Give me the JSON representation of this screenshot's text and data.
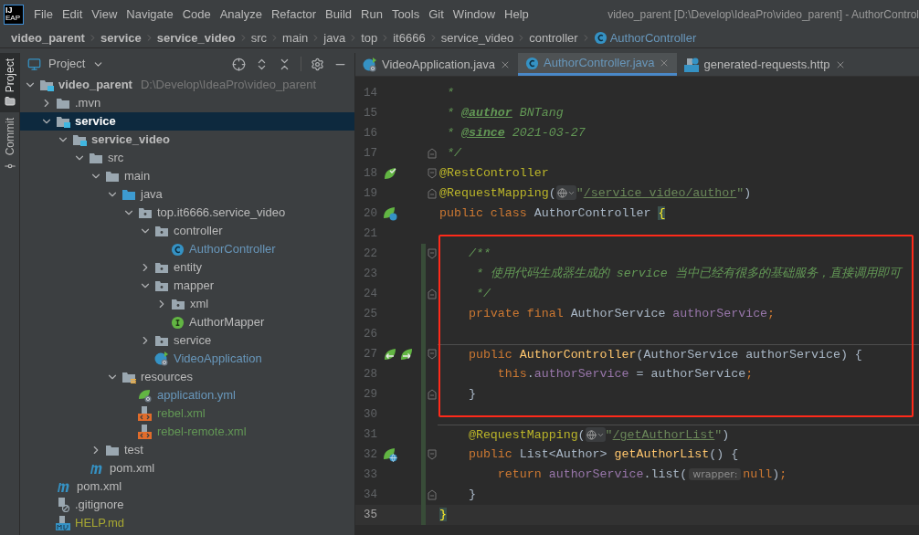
{
  "logo": {
    "top": "IJ",
    "bottom": "EAP"
  },
  "menu": [
    "File",
    "Edit",
    "View",
    "Navigate",
    "Code",
    "Analyze",
    "Refactor",
    "Build",
    "Run",
    "Tools",
    "Git",
    "Window",
    "Help"
  ],
  "window": {
    "title": "video_parent [D:\\Develop\\IdeaPro\\video_parent] - AuthorControl"
  },
  "breadcrumbs": [
    {
      "label": "video_parent",
      "kind": "module"
    },
    {
      "label": "service",
      "kind": "module"
    },
    {
      "label": "service_video",
      "kind": "module"
    },
    {
      "label": "src",
      "kind": "folder"
    },
    {
      "label": "main",
      "kind": "folder"
    },
    {
      "label": "java",
      "kind": "folder"
    },
    {
      "label": "top",
      "kind": "folder"
    },
    {
      "label": "it6666",
      "kind": "folder"
    },
    {
      "label": "service_video",
      "kind": "folder"
    },
    {
      "label": "controller",
      "kind": "folder"
    },
    {
      "label": "AuthorController",
      "kind": "class"
    }
  ],
  "stripe_tabs": [
    {
      "label": "Project",
      "kind": "project",
      "selected": true
    },
    {
      "label": "Commit",
      "kind": "commit",
      "selected": false
    }
  ],
  "project": {
    "title": "Project",
    "tree": [
      {
        "label": "video_parent",
        "path": "D:\\Develop\\IdeaPro\\video_parent",
        "kind": "module",
        "bold": true,
        "color": "#bbbbbb",
        "expanded": true,
        "selected": false,
        "children": [
          {
            "label": ".mvn",
            "kind": "folder",
            "bold": false,
            "color": "#bbbbbb",
            "expanded": false,
            "selected": false
          },
          {
            "label": "service",
            "kind": "module",
            "bold": true,
            "expanded": true,
            "selected": true,
            "children": [
              {
                "label": "service_video",
                "kind": "module",
                "bold": true,
                "color": "#bbbbbb",
                "expanded": true,
                "selected": false,
                "children": [
                  {
                    "label": "src",
                    "kind": "folder",
                    "bold": false,
                    "color": "#bbbbbb",
                    "expanded": true,
                    "selected": false,
                    "children": [
                      {
                        "label": "main",
                        "kind": "folder",
                        "bold": false,
                        "color": "#bbbbbb",
                        "expanded": true,
                        "selected": false,
                        "children": [
                          {
                            "label": "java",
                            "kind": "source",
                            "bold": false,
                            "color": "#bbbbbb",
                            "expanded": true,
                            "selected": false,
                            "children": [
                              {
                                "label": "top.it6666.service_video",
                                "kind": "package",
                                "bold": false,
                                "color": "#bbbbbb",
                                "expanded": true,
                                "selected": false,
                                "children": [
                                  {
                                    "label": "controller",
                                    "kind": "package",
                                    "bold": false,
                                    "color": "#bbbbbb",
                                    "expanded": true,
                                    "selected": false,
                                    "children": [
                                      {
                                        "label": "AuthorController",
                                        "kind": "class",
                                        "bold": false,
                                        "color": "#6897bb",
                                        "selected": false
                                      }
                                    ]
                                  },
                                  {
                                    "label": "entity",
                                    "kind": "package",
                                    "bold": false,
                                    "color": "#bbbbbb",
                                    "expanded": false,
                                    "selected": false
                                  },
                                  {
                                    "label": "mapper",
                                    "kind": "package",
                                    "bold": false,
                                    "color": "#bbbbbb",
                                    "expanded": true,
                                    "selected": false,
                                    "children": [
                                      {
                                        "label": "xml",
                                        "kind": "package",
                                        "bold": false,
                                        "color": "#bbbbbb",
                                        "expanded": false,
                                        "selected": false
                                      },
                                      {
                                        "label": "AuthorMapper",
                                        "kind": "interface",
                                        "bold": false,
                                        "color": "#bbbbbb",
                                        "selected": false
                                      }
                                    ]
                                  },
                                  {
                                    "label": "service",
                                    "kind": "package",
                                    "bold": false,
                                    "color": "#bbbbbb",
                                    "expanded": false,
                                    "selected": false
                                  },
                                  {
                                    "label": "VideoApplication",
                                    "kind": "spring-class",
                                    "bold": false,
                                    "color": "#6897bb",
                                    "selected": false
                                  }
                                ]
                              }
                            ]
                          },
                          {
                            "label": "resources",
                            "kind": "resources",
                            "bold": false,
                            "color": "#bbbbbb",
                            "expanded": true,
                            "selected": false,
                            "children": [
                              {
                                "label": "application.yml",
                                "kind": "spring-yml",
                                "bold": false,
                                "color": "#6897bb",
                                "selected": false
                              },
                              {
                                "label": "rebel.xml",
                                "kind": "xml",
                                "bold": false,
                                "color": "#629755",
                                "selected": false
                              },
                              {
                                "label": "rebel-remote.xml",
                                "kind": "xml",
                                "bold": false,
                                "color": "#629755",
                                "selected": false
                              }
                            ]
                          }
                        ]
                      },
                      {
                        "label": "test",
                        "kind": "folder",
                        "bold": false,
                        "color": "#bbbbbb",
                        "expanded": false,
                        "selected": false
                      }
                    ]
                  },
                  {
                    "label": "pom.xml",
                    "kind": "maven",
                    "bold": false,
                    "color": "#bbbbbb",
                    "selected": false
                  }
                ]
              }
            ]
          },
          {
            "label": "pom.xml",
            "kind": "maven",
            "bold": false,
            "color": "#bbbbbb",
            "selected": false
          },
          {
            "label": ".gitignore",
            "kind": "gitignore",
            "bold": false,
            "color": "#bbbbbb",
            "selected": false
          },
          {
            "label": "HELP.md",
            "kind": "markdown",
            "bold": false,
            "color": "#a8a832",
            "selected": false
          }
        ]
      }
    ]
  },
  "tabs": [
    {
      "label": "VideoApplication.java",
      "kind": "spring-class",
      "selected": false
    },
    {
      "label": "AuthorController.java",
      "kind": "class",
      "selected": true
    },
    {
      "label": "generated-requests.http",
      "kind": "http",
      "selected": false
    }
  ],
  "editor": {
    "blocks": [
      {
        "highlighted": false,
        "changed": false,
        "lines": [
          {
            "number": "14",
            "current": false,
            "separator": false,
            "tokens": [
              {
                "text": " *",
                "kind": "comment"
              }
            ]
          },
          {
            "number": "15",
            "current": false,
            "separator": false,
            "tokens": [
              {
                "text": " * ",
                "kind": "comment"
              },
              {
                "text": "@author",
                "kind": "doctag"
              },
              {
                "text": " BNTang",
                "kind": "comment"
              }
            ]
          },
          {
            "number": "16",
            "current": false,
            "separator": false,
            "tokens": [
              {
                "text": " * ",
                "kind": "comment"
              },
              {
                "text": "@since",
                "kind": "doctag"
              },
              {
                "text": " 2021-03-27",
                "kind": "comment"
              }
            ]
          },
          {
            "number": "17",
            "current": false,
            "separator": false,
            "fold_end": true,
            "tokens": [
              {
                "text": " */",
                "kind": "comment"
              }
            ]
          },
          {
            "number": "18",
            "current": false,
            "separator": false,
            "fold_start": true,
            "gutter": [
              {
                "kind": "bean-check"
              }
            ],
            "tokens": [
              {
                "text": "@RestController",
                "kind": "annotation"
              }
            ]
          },
          {
            "number": "19",
            "current": false,
            "separator": false,
            "fold_end": true,
            "tokens": [
              {
                "text": "@RequestMapping",
                "kind": "annotation"
              },
              {
                "text": "(",
                "kind": "plain"
              },
              {
                "kind": "globe"
              },
              {
                "text": "\"",
                "kind": "string"
              },
              {
                "text": "/service_video/author",
                "kind": "link"
              },
              {
                "text": "\"",
                "kind": "string"
              },
              {
                "text": ")",
                "kind": "plain"
              }
            ]
          },
          {
            "number": "20",
            "current": false,
            "separator": false,
            "gutter": [
              {
                "kind": "bean"
              }
            ],
            "tokens": [
              {
                "text": "public class ",
                "kind": "keyword"
              },
              {
                "text": "AuthorController ",
                "kind": "plain"
              },
              {
                "text": "{",
                "kind": "brace"
              }
            ]
          },
          {
            "number": "21",
            "current": false,
            "separator": false
          }
        ]
      },
      {
        "highlighted": true,
        "changed": true,
        "lines": [
          {
            "number": "22",
            "current": false,
            "separator": false,
            "fold_start": true,
            "tokens": [
              {
                "text": "    /**",
                "kind": "comment"
              }
            ]
          },
          {
            "number": "23",
            "current": false,
            "separator": false,
            "tokens": [
              {
                "text": "     * 使用代码生成器生成的 service 当中已经有很多的基础服务，直接调用即可",
                "kind": "comment"
              }
            ]
          },
          {
            "number": "24",
            "current": false,
            "separator": false,
            "fold_end": true,
            "tokens": [
              {
                "text": "     */",
                "kind": "comment"
              }
            ]
          },
          {
            "number": "25",
            "current": false,
            "separator": false,
            "tokens": [
              {
                "text": "    private final ",
                "kind": "keyword"
              },
              {
                "text": "AuthorService ",
                "kind": "plain"
              },
              {
                "text": "authorService",
                "kind": "field"
              },
              {
                "text": ";",
                "kind": "keyword"
              }
            ]
          },
          {
            "number": "26",
            "current": false,
            "separator": false
          },
          {
            "number": "27",
            "current": false,
            "separator": true,
            "fold_start": true,
            "gutter": [
              {
                "kind": "inject-left"
              },
              {
                "kind": "inject-right"
              }
            ],
            "tokens": [
              {
                "text": "    public ",
                "kind": "keyword"
              },
              {
                "text": "AuthorController",
                "kind": "method"
              },
              {
                "text": "(AuthorService authorService) {",
                "kind": "plain"
              }
            ]
          },
          {
            "number": "28",
            "current": false,
            "separator": false,
            "tokens": [
              {
                "text": "        this",
                "kind": "keyword"
              },
              {
                "text": ".",
                "kind": "plain"
              },
              {
                "text": "authorService",
                "kind": "field"
              },
              {
                "text": " = authorService",
                "kind": "plain"
              },
              {
                "text": ";",
                "kind": "keyword"
              }
            ]
          },
          {
            "number": "29",
            "current": false,
            "separator": false,
            "fold_end": true,
            "tokens": [
              {
                "text": "    }",
                "kind": "plain"
              }
            ]
          }
        ]
      },
      {
        "highlighted": false,
        "changed": true,
        "lines": [
          {
            "number": "30",
            "current": false,
            "separator": false
          },
          {
            "number": "31",
            "current": false,
            "separator": true,
            "tokens": [
              {
                "text": "    @RequestMapping",
                "kind": "annotation"
              },
              {
                "text": "(",
                "kind": "plain"
              },
              {
                "kind": "globe"
              },
              {
                "text": "\"",
                "kind": "string"
              },
              {
                "text": "/getAuthorList",
                "kind": "link"
              },
              {
                "text": "\"",
                "kind": "string"
              },
              {
                "text": ")",
                "kind": "plain"
              }
            ]
          },
          {
            "number": "32",
            "current": false,
            "separator": false,
            "fold_start": true,
            "gutter": [
              {
                "kind": "web"
              }
            ],
            "tokens": [
              {
                "text": "    public ",
                "kind": "keyword"
              },
              {
                "text": "List<Author> ",
                "kind": "plain"
              },
              {
                "text": "getAuthorList",
                "kind": "method"
              },
              {
                "text": "() {",
                "kind": "plain"
              }
            ]
          },
          {
            "number": "33",
            "current": false,
            "separator": false,
            "tokens": [
              {
                "text": "        return ",
                "kind": "keyword"
              },
              {
                "text": "authorService",
                "kind": "field"
              },
              {
                "text": ".list(",
                "kind": "plain"
              },
              {
                "text": "wrapper:",
                "kind": "hint"
              },
              {
                "text": "null",
                "kind": "keyword"
              },
              {
                "text": ")",
                "kind": "plain"
              },
              {
                "text": ";",
                "kind": "keyword"
              }
            ]
          },
          {
            "number": "34",
            "current": false,
            "separator": false,
            "fold_end": true,
            "tokens": [
              {
                "text": "    }",
                "kind": "plain"
              }
            ]
          },
          {
            "number": "35",
            "current": true,
            "separator": false,
            "tokens": [
              {
                "text": "}",
                "kind": "brace"
              }
            ]
          }
        ]
      }
    ]
  }
}
